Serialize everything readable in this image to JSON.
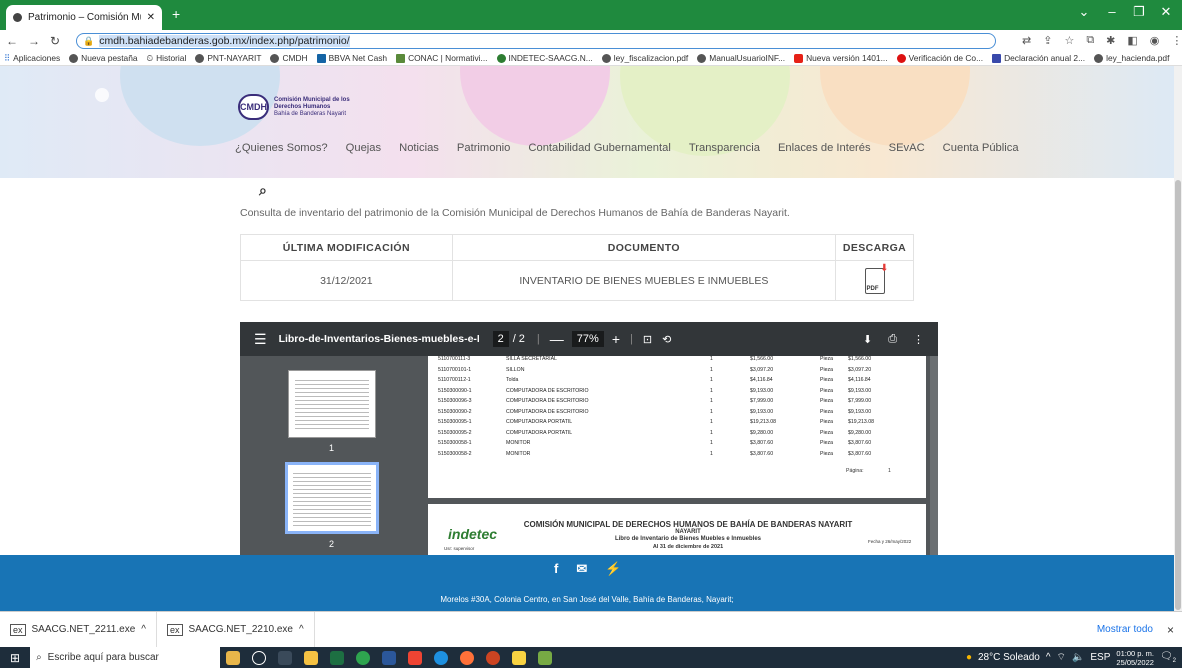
{
  "browser": {
    "tab_title": "Patrimonio – Comisión Municipa",
    "url": "cmdh.bahiadebanderas.gob.mx/index.php/patrimonio/",
    "bookmarks": [
      "Aplicaciones",
      "Nueva pestaña",
      "Historial",
      "PNT-NAYARIT",
      "CMDH",
      "BBVA Net Cash",
      "CONAC | Normativi...",
      "INDETEC-SAACG.N...",
      "ley_fiscalizacion.pdf",
      "ManualUsuarioINF...",
      "Nueva versión 1401...",
      "Verificación de Co...",
      "Declaración anual 2...",
      "ley_hacienda.pdf"
    ]
  },
  "site": {
    "logo_text": "CMDH",
    "logo_sub": "Comisión Municipal de los Derechos Humanos",
    "logo_tag": "Bahía de Banderas Nayarit",
    "nav": [
      "¿Quienes Somos?",
      "Quejas",
      "Noticias",
      "Patrimonio",
      "Contabilidad Gubernamental",
      "Transparencia",
      "Enlaces de Interés",
      "SEvAC",
      "Cuenta Pública"
    ],
    "search_icon": "⌕",
    "intro": "Consulta de inventario del patrimonio de la Comisión Municipal de Derechos Humanos de Bahía de Banderas Nayarit.",
    "table": {
      "headers": [
        "ÚLTIMA MODIFICACIÓN",
        "DOCUMENTO",
        "DESCARGA"
      ],
      "date": "31/12/2021",
      "document": "INVENTARIO DE BIENES MUEBLES E INMUEBLES",
      "pdf_label": "PDF"
    }
  },
  "pdf": {
    "filename": "Libro-de-Inventarios-Bienes-muebles-e-Inmuebles.p...",
    "page": "2",
    "pages": "/ 2",
    "zoom": "77%",
    "thumb_labels": [
      "1",
      "2"
    ],
    "rows": [
      [
        "5110700111-3",
        "SILLA SECRETARIAL",
        "1",
        "$1,566.00",
        "Pieza",
        "$1,566.00"
      ],
      [
        "5110700101-1",
        "SILLON",
        "1",
        "$3,097.20",
        "Pieza",
        "$3,097.20"
      ],
      [
        "5110700112-1",
        "Tolda",
        "1",
        "$4,116.84",
        "Pieza",
        "$4,116.84"
      ],
      [
        "5150300090-1",
        "COMPUTADORA DE ESCRITORIO",
        "1",
        "$9,193.00",
        "Pieza",
        "$9,193.00"
      ],
      [
        "5150300096-3",
        "COMPUTADORA DE ESCRITORIO",
        "1",
        "$7,999.00",
        "Pieza",
        "$7,999.00"
      ],
      [
        "5150300090-2",
        "COMPUTADORA DE ESCRITORIO",
        "1",
        "$9,193.00",
        "Pieza",
        "$9,193.00"
      ],
      [
        "5150300095-1",
        "COMPUTADORA PORTATIL",
        "1",
        "$19,213.08",
        "Pieza",
        "$19,213.08"
      ],
      [
        "5150300095-2",
        "COMPUTADORA PORTATIL",
        "1",
        "$9,280.00",
        "Pieza",
        "$9,280.00"
      ],
      [
        "5150300058-1",
        "MONITOR",
        "1",
        "$3,807.60",
        "Pieza",
        "$3,807.60"
      ],
      [
        "5150300058-2",
        "MONITOR",
        "1",
        "$3,807.60",
        "Pieza",
        "$3,807.60"
      ]
    ],
    "page_footer_label": "Página:",
    "page_footer_num": "1",
    "header_org": "COMISIÓN MUNICIPAL DE DERECHOS HUMANOS DE BAHÍA DE BANDERAS NAYARIT",
    "header_state": "NAYARIT",
    "header_book": "Libro de Inventario de Bienes Muebles e Inmuebles",
    "header_date": "Al 31 de diciembre de 2021",
    "header_logo": "indetec",
    "header_fecha": "Fecha y 26/may/2022",
    "header_user": "Usr: supervisor"
  },
  "footer": {
    "address": "Morelos #30A, Colonia Centro, en San José del Valle, Bahía de Banderas, Nayarit;",
    "icons": [
      "f",
      "✉",
      "⚡"
    ]
  },
  "downloads": {
    "items": [
      "SAACG.NET_2211.exe",
      "SAACG.NET_2210.exe"
    ],
    "show_all": "Mostrar todo",
    "close": "×"
  },
  "taskbar": {
    "search_placeholder": "Escribe aquí para buscar",
    "weather": "28°C Soleado",
    "lang": "ESP",
    "time": "01:00 p. m.",
    "date": "25/05/2022",
    "notif": "2"
  }
}
